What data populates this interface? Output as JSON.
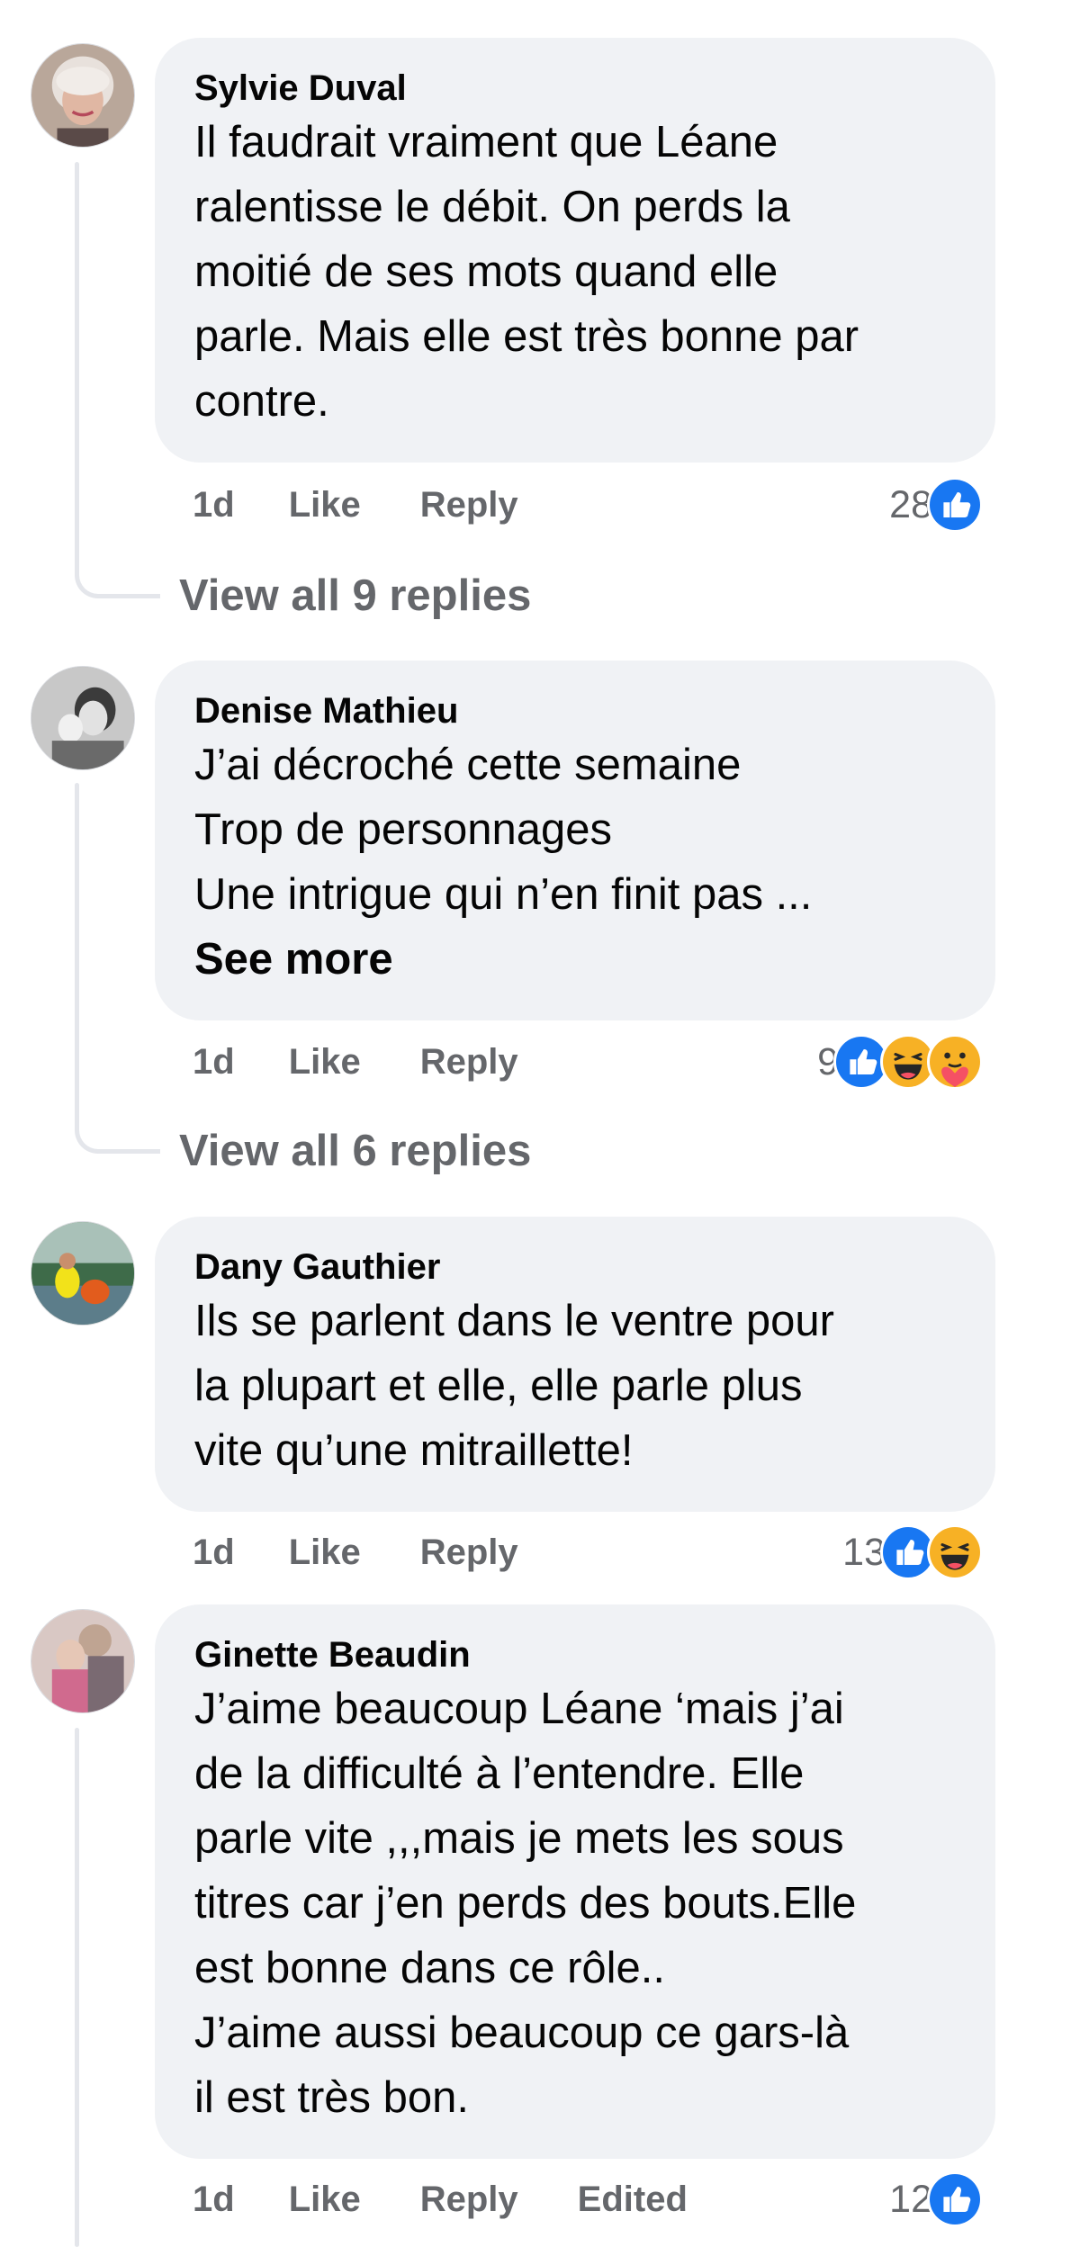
{
  "comments": [
    {
      "author": "Sylvie Duval",
      "lines": [
        "Il faudrait vraiment que Léane",
        "ralentisse le débit. On perds la",
        "moitié de ses mots quand elle",
        "parle. Mais elle est très bonne par",
        "contre."
      ],
      "time": "1d",
      "like": "Like",
      "reply": "Reply",
      "reaction_count": "28",
      "reactions": [
        "like-icon"
      ],
      "view_replies": "View all 9 replies"
    },
    {
      "author": "Denise Mathieu",
      "lines": [
        "J’ai décroché cette semaine",
        "Trop de personnages",
        "Une intrigue qui n’en finit pas ..."
      ],
      "see_more": "See more",
      "time": "1d",
      "like": "Like",
      "reply": "Reply",
      "reaction_count": "9",
      "reactions": [
        "like-icon",
        "haha-icon",
        "care-icon"
      ],
      "view_replies": "View all 6 replies"
    },
    {
      "author": "Dany Gauthier",
      "lines": [
        "Ils se parlent dans le ventre pour",
        "la plupart et elle, elle parle plus",
        "vite qu’une mitraillette!"
      ],
      "time": "1d",
      "like": "Like",
      "reply": "Reply",
      "reaction_count": "13",
      "reactions": [
        "like-icon",
        "haha-icon"
      ]
    },
    {
      "author": "Ginette Beaudin",
      "lines": [
        "J’aime beaucoup Léane ‘mais j’ai",
        "de la difficulté à l’entendre. Elle",
        "parle vite ,,,mais je mets les sous",
        "titres car j’en perds des bouts.Elle",
        "est bonne dans ce rôle..",
        "J’aime aussi beaucoup ce gars-là",
        "il est très bon."
      ],
      "time": "1d",
      "like": "Like",
      "reply": "Reply",
      "edited": "Edited",
      "reaction_count": "12",
      "reactions": [
        "like-icon"
      ]
    }
  ],
  "colors": {
    "bubble": "#f0f2f5",
    "secondary_text": "#65676b",
    "like_blue": "#1877f2",
    "thread_line": "#e4e6eb"
  }
}
